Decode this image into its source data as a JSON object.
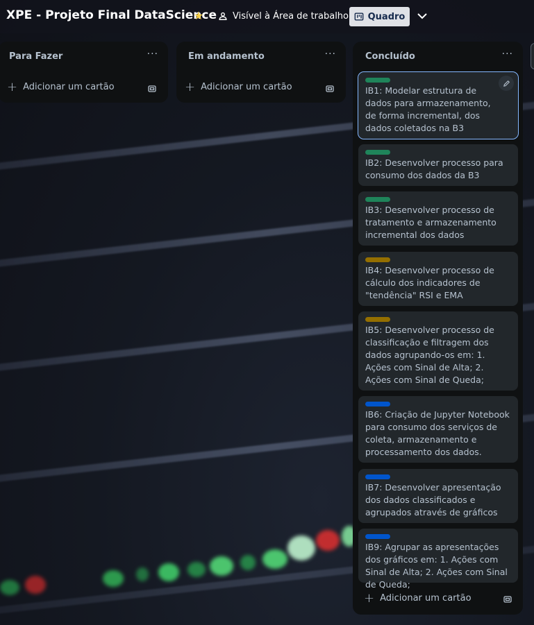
{
  "header": {
    "board_title": "XPE - Projeto Final DataScience",
    "visibility_label": "Visível à Área de trabalho",
    "view_label": "Quadro",
    "star_color": "#f5cd47"
  },
  "lists": [
    {
      "title": "Para Fazer",
      "menu": "···",
      "add_label": "Adicionar um cartão"
    },
    {
      "title": "Em andamento",
      "menu": "···",
      "add_label": "Adicionar um cartão"
    },
    {
      "title": "Concluído",
      "menu": "···",
      "add_label": "Adicionar um cartão"
    }
  ],
  "cards": [
    {
      "label_color": "#1f845a",
      "title": "IB1: Modelar estrutura de dados para armazenamento, de forma incremental, dos dados coletados na B3"
    },
    {
      "label_color": "#1f845a",
      "title": "IB2: Desenvolver processo para consumo dos dados da B3"
    },
    {
      "label_color": "#1f845a",
      "title": "IB3: Desenvolver processo de tratamento e armazenamento incremental dos dados"
    },
    {
      "label_color": "#946f00",
      "title": "IB4: Desenvolver processo de cálculo dos indicadores de \"tendência\" RSI e EMA"
    },
    {
      "label_color": "#946f00",
      "title": "IB5: Desenvolver processo de classificação e filtragem dos dados agrupando-os em: 1. Ações com Sinal de Alta; 2. Ações com Sinal de Queda;"
    },
    {
      "label_color": "#0055cc",
      "title": "IB6: Criação de Jupyter Notebook para consumo dos serviços de coleta, armazenamento e processamento dos dados."
    },
    {
      "label_color": "#0055cc",
      "title": "IB7: Desenvolver apresentação dos dados classificados e agrupados através de gráficos"
    },
    {
      "label_color": "#0055cc",
      "title": "IB9: Agrupar as apresentações dos gráficos em: 1. Ações com Sinal de Alta; 2. Ações com Sinal de Queda;"
    }
  ]
}
